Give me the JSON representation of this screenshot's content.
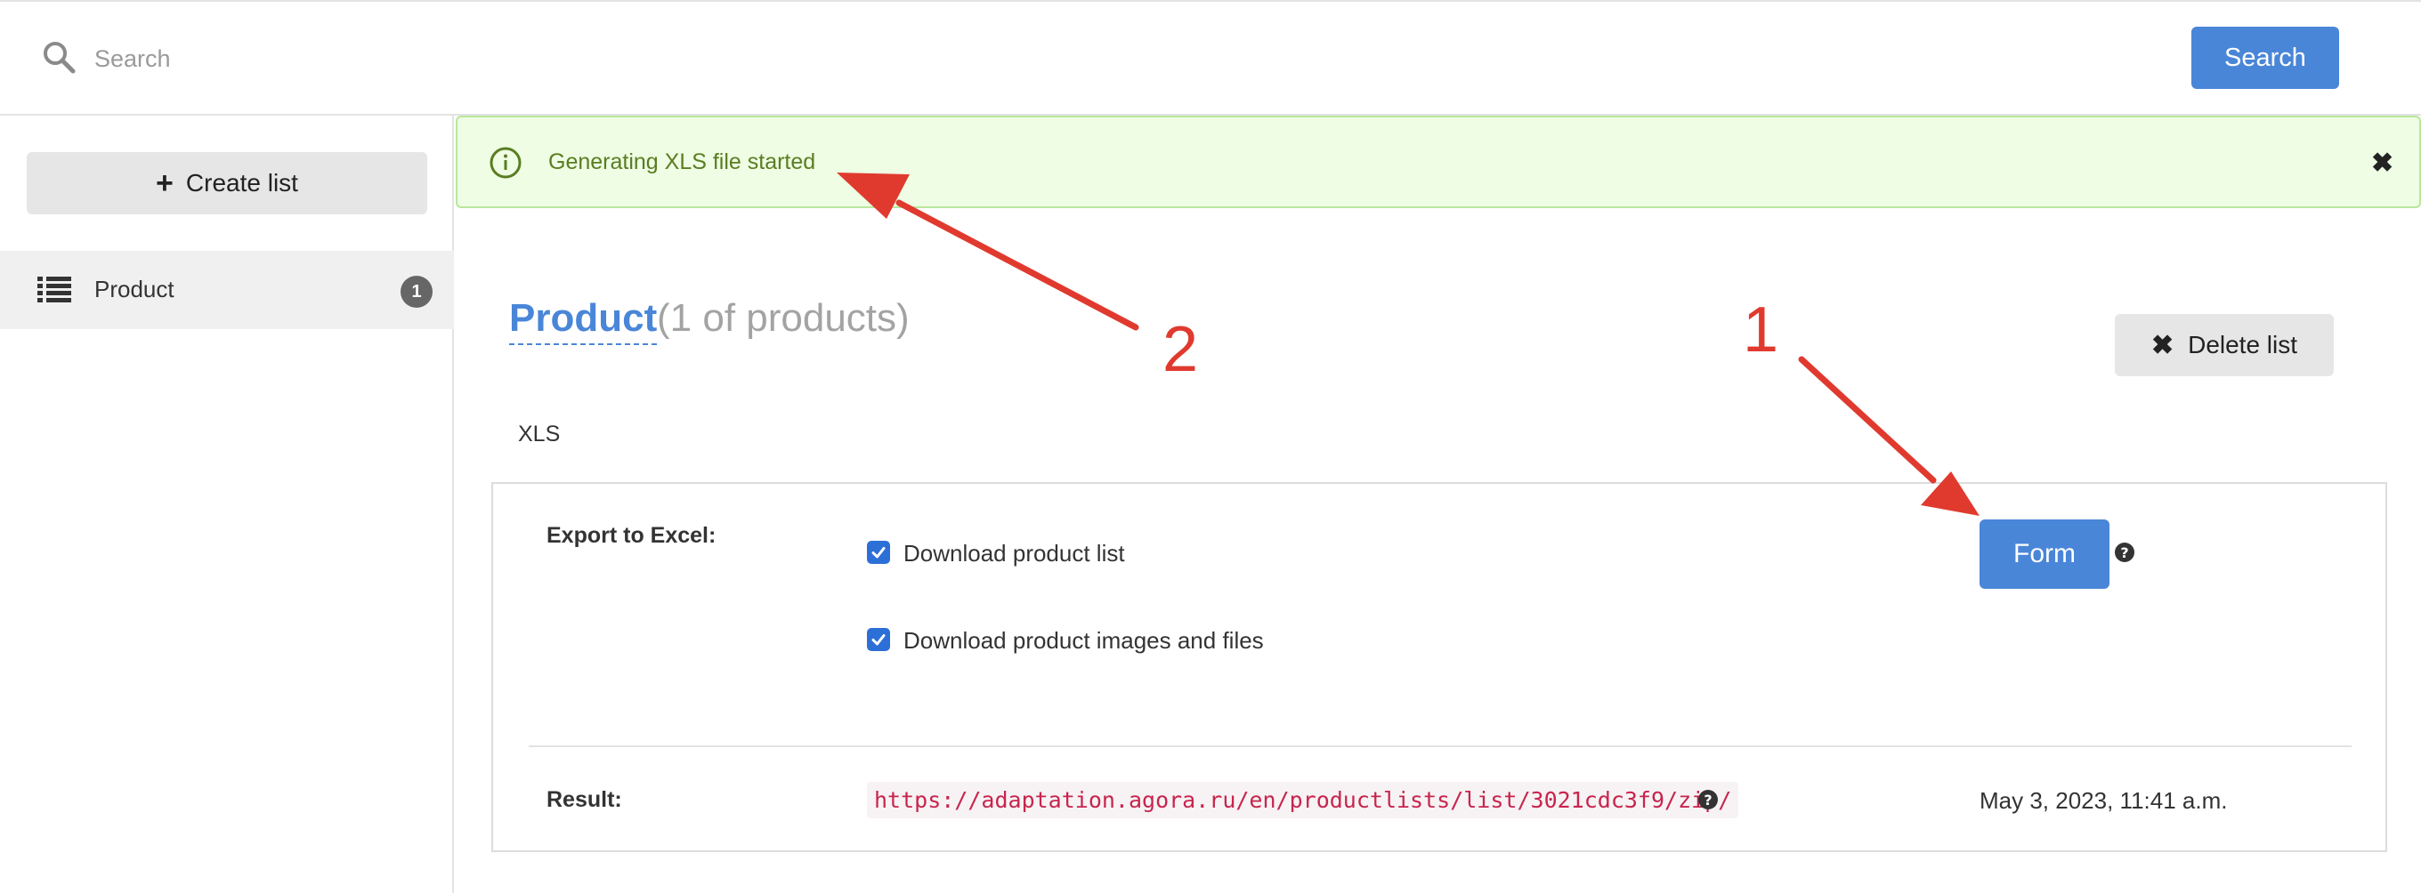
{
  "search": {
    "placeholder": "Search",
    "button_label": "Search"
  },
  "sidebar": {
    "create_label": "Create list",
    "items": [
      {
        "label": "Product",
        "count": "1"
      }
    ]
  },
  "alert": {
    "message": "Generating XLS file started",
    "close_glyph": "✖"
  },
  "page": {
    "title": "Product",
    "subtitle": "(1 of products)",
    "delete_label": "Delete list",
    "tab": "XLS"
  },
  "export": {
    "label": "Export to Excel:",
    "options": [
      {
        "label": "Download product list",
        "checked": true
      },
      {
        "label": "Download product images and files",
        "checked": true
      }
    ],
    "form_button": "Form",
    "help_glyph": "?"
  },
  "result": {
    "label": "Result:",
    "url": "https://adaptation.agora.ru/en/productlists/list/3021cdc3f9/zip/",
    "date": "May 3, 2023, 11:41 a.m."
  },
  "annotations": {
    "arrow1": "1",
    "arrow2": "2"
  },
  "colors": {
    "primary": "#4a86d8",
    "alert_bg": "#eefde3",
    "alert_text": "#5a7d22",
    "annotation": "#e03a2f",
    "code": "#c7254e"
  }
}
